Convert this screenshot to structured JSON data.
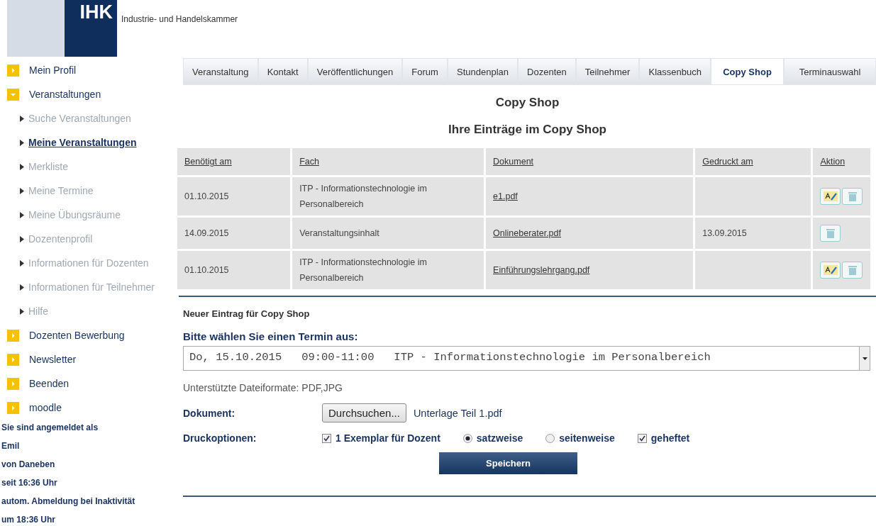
{
  "header": {
    "logo_text": "IHK",
    "title": "Industrie- und Handelskammer"
  },
  "sidebar": {
    "items": [
      {
        "label": "Mein Profil",
        "expanded": false
      },
      {
        "label": "Veranstaltungen",
        "expanded": true,
        "children": [
          {
            "label": "Suche Veranstaltungen",
            "selected": false
          },
          {
            "label": "Meine Veranstaltungen",
            "selected": true
          },
          {
            "label": "Merkliste",
            "selected": false
          },
          {
            "label": "Meine Termine",
            "selected": false
          },
          {
            "label": "Meine Übungsräume",
            "selected": false
          },
          {
            "label": "Dozentenprofil",
            "selected": false
          },
          {
            "label": "Informationen für Dozenten",
            "selected": false
          },
          {
            "label": "Informationen für Teilnehmer",
            "selected": false
          },
          {
            "label": "Hilfe",
            "selected": false
          }
        ]
      },
      {
        "label": "Dozenten Bewerbung",
        "expanded": false
      },
      {
        "label": "Newsletter",
        "expanded": false
      },
      {
        "label": "Beenden",
        "expanded": false
      },
      {
        "label": "moodle",
        "expanded": false
      }
    ],
    "login_info": [
      "Sie sind angemeldet als",
      "Emil",
      "von Daneben",
      "seit 16:36 Uhr",
      "autom. Abmeldung bei Inaktivität",
      "um 18:36 Uhr"
    ]
  },
  "tabs": [
    {
      "label": "Veranstaltung",
      "selected": false
    },
    {
      "label": "Kontakt",
      "selected": false
    },
    {
      "label": "Veröffentlichungen",
      "selected": false
    },
    {
      "label": "Forum",
      "selected": false
    },
    {
      "label": "Stundenplan",
      "selected": false
    },
    {
      "label": "Dozenten",
      "selected": false
    },
    {
      "label": "Teilnehmer",
      "selected": false
    },
    {
      "label": "Klassenbuch",
      "selected": false
    },
    {
      "label": "Copy Shop",
      "selected": true
    },
    {
      "label": "Terminauswahl",
      "selected": false
    }
  ],
  "page_title": "Copy Shop",
  "subtitle": "Ihre Einträge im Copy Shop",
  "table": {
    "columns": [
      "Benötigt am",
      "Fach",
      "Dokument",
      "Gedruckt am",
      "Aktion"
    ],
    "rows": [
      {
        "needed": "01.10.2015",
        "subject": "ITP - Informationstechnologie im Personalbereich",
        "document": "e1.pdf",
        "printed": "",
        "actions": [
          {
            "kind": "edit"
          },
          {
            "kind": "delete"
          }
        ]
      },
      {
        "needed": "14.09.2015",
        "subject": "Veranstaltungsinhalt",
        "document": "Onlineberater.pdf",
        "printed": "13.09.2015",
        "actions": [
          {
            "kind": "delete"
          }
        ]
      },
      {
        "needed": "01.10.2015",
        "subject": "ITP - Informationstechnologie im Personalbereich",
        "document": "Einführungslehrgang.pdf",
        "printed": "",
        "actions": [
          {
            "kind": "edit"
          },
          {
            "kind": "delete"
          }
        ]
      }
    ]
  },
  "form": {
    "title": "Neuer Eintrag für Copy Shop",
    "select_label": "Bitte wählen Sie einen Termin aus:",
    "select_value": "Do, 15.10.2015   09:00-11:00   ITP - Informationstechnologie im Personalbereich",
    "formats_note": "Unterstützte Dateiformate: PDF,JPG",
    "document_label": "Dokument:",
    "browse_button": "Durchsuchen...",
    "file_name": "Unterlage Teil 1.pdf",
    "options_label": "Druckoptionen:",
    "options": [
      {
        "kind": "checkbox",
        "label": "1 Exemplar für Dozent",
        "checked": true
      },
      {
        "kind": "radio",
        "label": "satzweise",
        "selected": true
      },
      {
        "kind": "radio",
        "label": "seitenweise",
        "selected": false
      },
      {
        "kind": "checkbox",
        "label": "geheftet",
        "checked": true
      }
    ],
    "save_button": "Speichern"
  }
}
